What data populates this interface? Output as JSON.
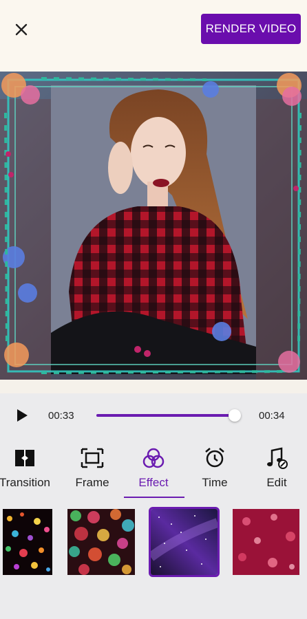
{
  "header": {
    "close_icon": "close-icon",
    "render_label": "RENDER VIDEO",
    "accent": "#6a0dad"
  },
  "player": {
    "current_time": "00:33",
    "total_time": "00:34",
    "progress": 0.97
  },
  "tabs": [
    {
      "label": "Transition",
      "icon": "transition-icon",
      "active": false
    },
    {
      "label": "Frame",
      "icon": "frame-icon",
      "active": false
    },
    {
      "label": "Effect",
      "icon": "effect-icon",
      "active": true
    },
    {
      "label": "Time",
      "icon": "alarm-clock-icon",
      "active": false
    },
    {
      "label": "Edit",
      "icon": "music-edit-icon",
      "active": false
    }
  ],
  "effects": [
    {
      "name": "bokeh-multicolor-effect",
      "selected": false
    },
    {
      "name": "bokeh-lights-effect",
      "selected": false
    },
    {
      "name": "galaxy-purple-effect",
      "selected": true
    },
    {
      "name": "bokeh-pink-effect",
      "selected": false
    }
  ]
}
